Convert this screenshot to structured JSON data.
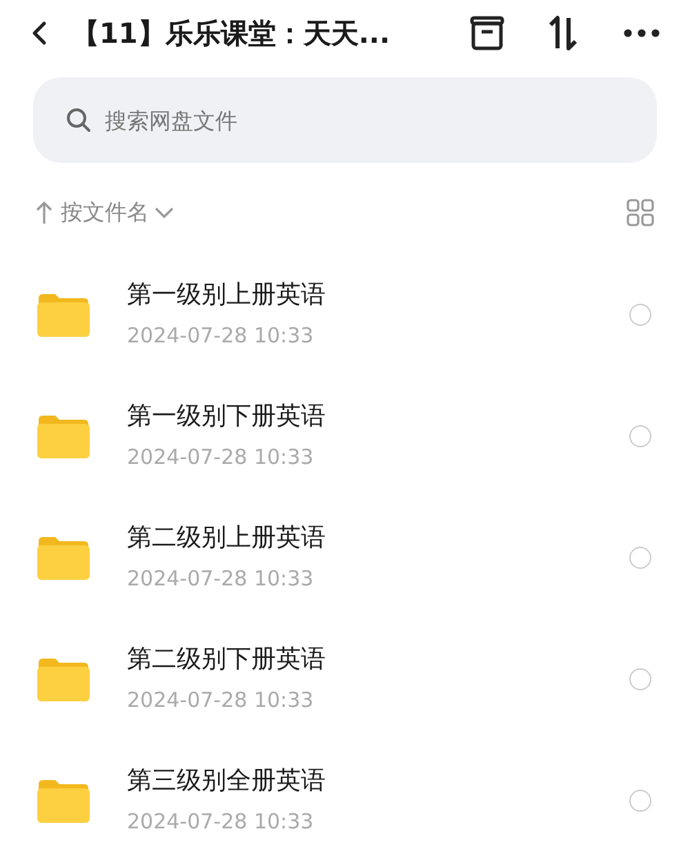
{
  "header": {
    "title": "【11】乐乐课堂：天天..."
  },
  "search": {
    "placeholder": "搜索网盘文件"
  },
  "sort": {
    "label": "按文件名"
  },
  "files": [
    {
      "name": "第一级别上册英语",
      "date": "2024-07-28  10:33",
      "selected": false
    },
    {
      "name": "第一级别下册英语",
      "date": "2024-07-28  10:33",
      "selected": false
    },
    {
      "name": "第二级别上册英语",
      "date": "2024-07-28  10:33",
      "selected": false
    },
    {
      "name": "第二级别下册英语",
      "date": "2024-07-28  10:33",
      "selected": false
    },
    {
      "name": "第三级别全册英语",
      "date": "2024-07-28  10:33",
      "selected": false
    }
  ]
}
